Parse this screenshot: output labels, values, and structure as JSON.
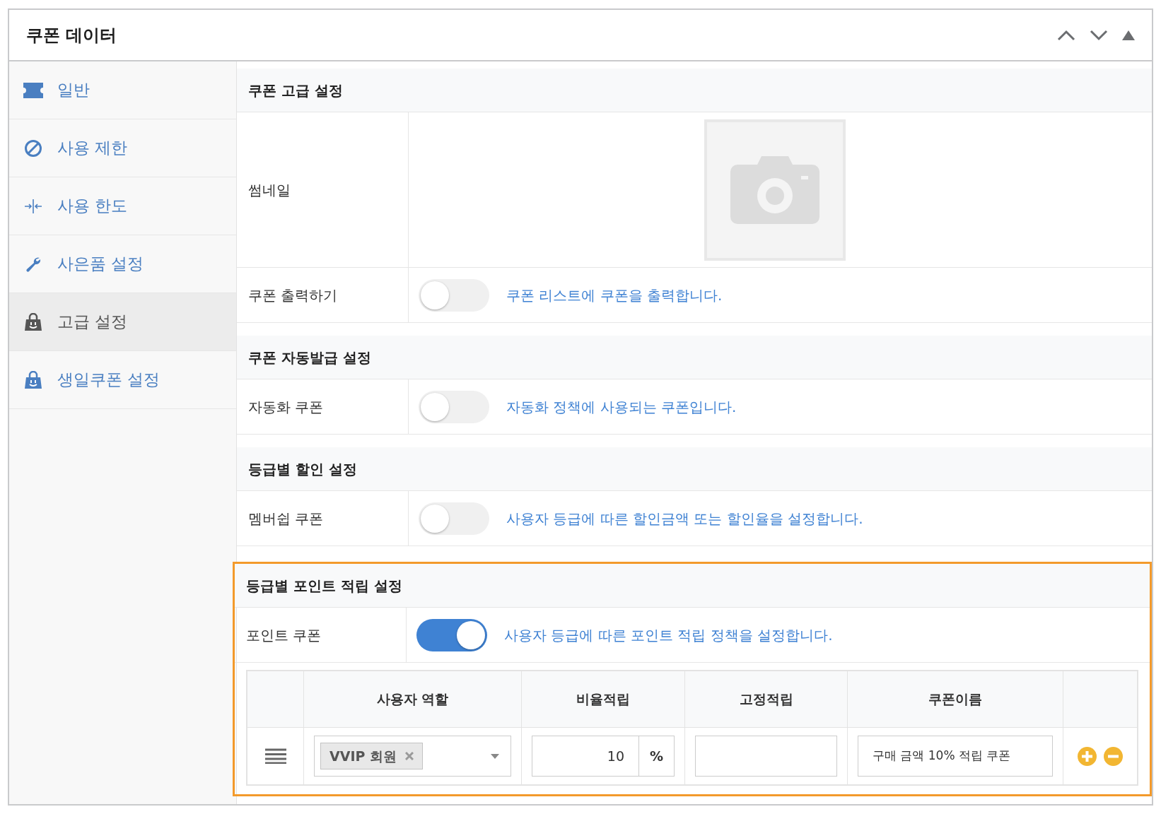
{
  "panel": {
    "title": "쿠폰 데이터"
  },
  "sidebar": {
    "items": [
      {
        "label": "일반",
        "selected": false
      },
      {
        "label": "사용 제한",
        "selected": false
      },
      {
        "label": "사용 한도",
        "selected": false
      },
      {
        "label": "사은품 설정",
        "selected": false
      },
      {
        "label": "고급 설정",
        "selected": true
      },
      {
        "label": "생일쿠폰 설정",
        "selected": false
      }
    ]
  },
  "sections": [
    {
      "title": "쿠폰 고급 설정",
      "highlighted": false,
      "rows": [
        {
          "kind": "thumbnail",
          "label": "썸네일"
        },
        {
          "kind": "toggle",
          "label": "쿠폰 출력하기",
          "on": false,
          "description": "쿠폰 리스트에 쿠폰을 출력합니다."
        }
      ]
    },
    {
      "title": "쿠폰 자동발급 설정",
      "highlighted": false,
      "rows": [
        {
          "kind": "toggle",
          "label": "자동화 쿠폰",
          "on": false,
          "description": "자동화 정책에 사용되는 쿠폰입니다."
        }
      ]
    },
    {
      "title": "등급별 할인 설정",
      "highlighted": false,
      "rows": [
        {
          "kind": "toggle",
          "label": "멤버쉽 쿠폰",
          "on": false,
          "description": "사용자 등급에 따른 할인금액 또는 할인율을 설정합니다."
        }
      ]
    },
    {
      "title": "등급별 포인트 적립 설정",
      "highlighted": true,
      "rows": [
        {
          "kind": "toggle",
          "label": "포인트 쿠폰",
          "on": true,
          "description": "사용자 등급에 따른 포인트 적립 정책을 설정합니다."
        }
      ],
      "table": {
        "columns": [
          "사용자 역할",
          "비율적립",
          "고정적립",
          "쿠폰이름"
        ],
        "rows": [
          {
            "role_tag": "VVIP 회원",
            "rate": "10",
            "rate_unit": "%",
            "coupon_name": "구매 금액 10% 적립 쿠폰"
          }
        ]
      }
    }
  ]
}
